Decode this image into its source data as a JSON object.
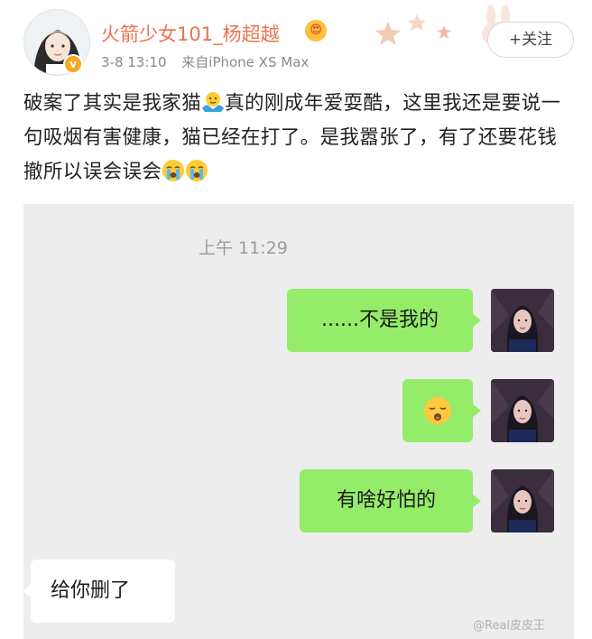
{
  "post": {
    "username": "火箭少女101_杨超越",
    "vip_badge": "😍",
    "verified_mark": "v",
    "time": "3-8 13:10",
    "source": "来自iPhone XS Max",
    "follow_label": "+关注",
    "text_1": "破案了其实是我家猫",
    "text_2": "真的刚成年爱耍酷，这里我还是要说一句吸烟有害健康，猫已经在打了。是我嚣张了，有了还要花钱撤所以误会误会",
    "icons": {
      "shrug_emoji": "shrug-emoji-icon",
      "crying_emoji": "crying-face-icon"
    }
  },
  "chat": {
    "time": "上午 11:29",
    "messages": [
      {
        "sender": "me",
        "text": "......不是我的"
      },
      {
        "sender": "me",
        "text": "",
        "emoji": "sleeping-face-icon"
      },
      {
        "sender": "me",
        "text": "有啥好怕的"
      },
      {
        "sender": "other",
        "text": "给你删了"
      }
    ]
  },
  "watermark": "@Real皮皮王",
  "colors": {
    "username": "#eb7350",
    "chat_background": "#ededed",
    "my_bubble": "#95ec69",
    "their_bubble": "#ffffff"
  }
}
